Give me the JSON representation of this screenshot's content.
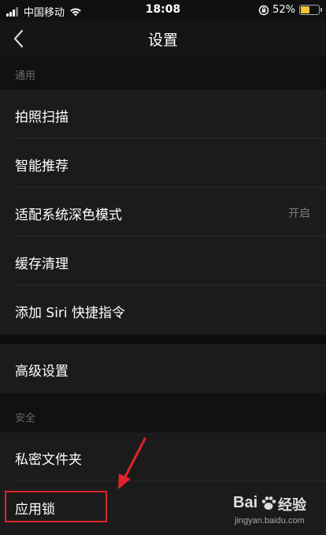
{
  "status_bar": {
    "carrier": "中国移动",
    "time": "18:08",
    "battery_percent": "52%",
    "battery_level": 0.52,
    "battery_color": "#f2c230",
    "icons": [
      "signal-icon",
      "wifi-icon",
      "rotation-lock-icon",
      "battery-icon"
    ]
  },
  "nav": {
    "title": "设置",
    "back_icon": "chevron-left-icon"
  },
  "sections": {
    "general": {
      "header": "通用",
      "items": [
        {
          "label": "拍照扫描"
        },
        {
          "label": "智能推荐"
        },
        {
          "label": "适配系统深色模式",
          "value": "开启"
        },
        {
          "label": "缓存清理"
        },
        {
          "label": "添加 Siri 快捷指令"
        }
      ]
    },
    "advanced": {
      "items": [
        {
          "label": "高级设置"
        }
      ]
    },
    "security": {
      "header": "安全",
      "items": [
        {
          "label": "私密文件夹"
        },
        {
          "label": "应用锁"
        }
      ]
    }
  },
  "annotation": {
    "highlight_color": "#e0232a"
  },
  "watermark": {
    "logo_text_1": "Bai",
    "logo_text_2": "经验",
    "url": "jingyan.baidu.com"
  },
  "colors": {
    "background": "#111111",
    "row_background": "#1b1b1b",
    "header_text": "#6a6a6a",
    "value_text": "#7a7a7a"
  }
}
